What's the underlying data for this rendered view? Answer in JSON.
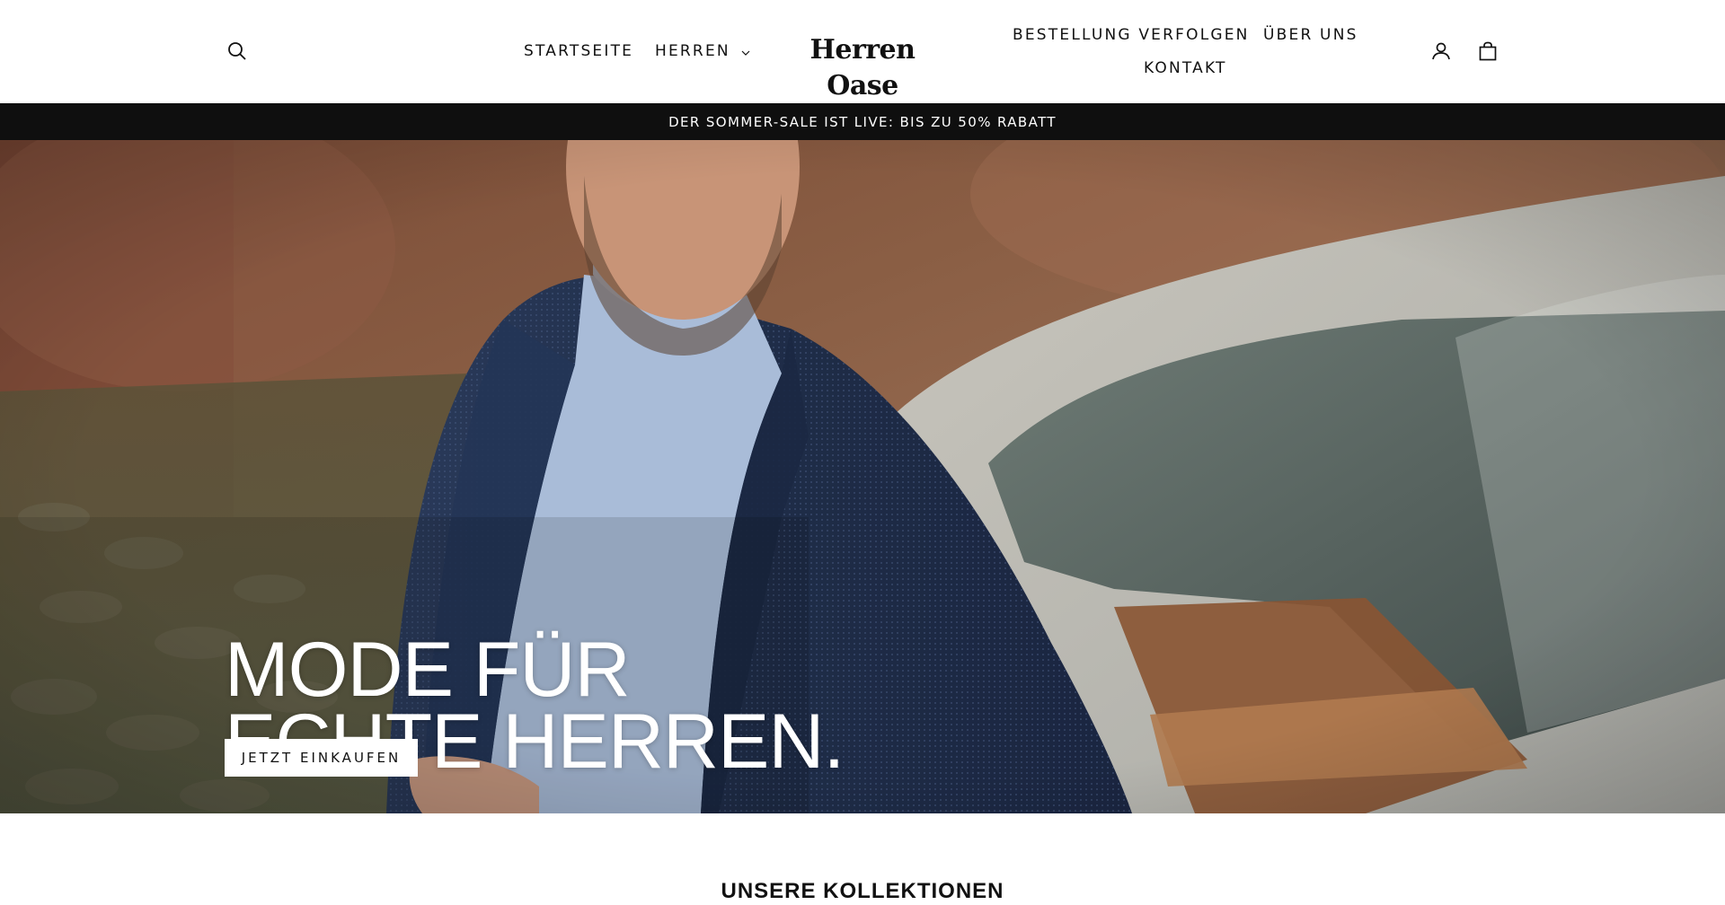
{
  "header": {
    "logo": "Herren Oase",
    "nav_left": [
      {
        "label": "STARTSEITE"
      },
      {
        "label": "HERREN"
      }
    ],
    "nav_right": [
      {
        "label": "BESTELLUNG VERFOLGEN"
      },
      {
        "label": "ÜBER UNS"
      },
      {
        "label": "KONTAKT"
      }
    ],
    "icons": [
      "search-icon",
      "user-icon",
      "cart-icon"
    ]
  },
  "announcement": {
    "text": "DER SOMMER-SALE IST LIVE: BIS ZU 50% RABATT"
  },
  "hero": {
    "title_line1": "MODE FÜR",
    "title_line2": "ECHTE HERREN.",
    "cta_label": "JETZT EINKAUFEN"
  },
  "collections": {
    "title": "UNSERE KOLLEKTIONEN"
  },
  "colors": {
    "announcement_bg": "#0f0f0f",
    "text": "#111111",
    "background": "#ffffff"
  }
}
